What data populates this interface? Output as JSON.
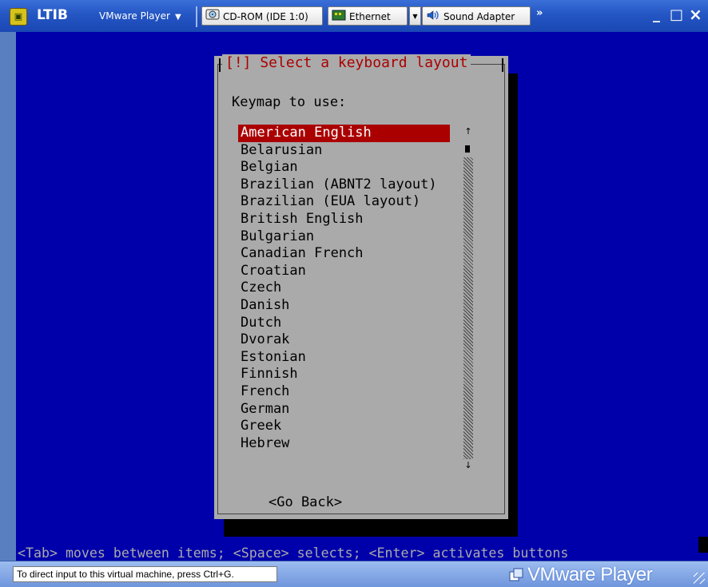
{
  "window": {
    "app_name": "LTIB",
    "menu_label": "VMware Player",
    "devices": [
      {
        "label": "CD-ROM (IDE 1:0)",
        "icon": "cdrom-icon"
      },
      {
        "label": "Ethernet",
        "icon": "network-icon"
      },
      {
        "label": "Sound Adapter",
        "icon": "speaker-icon"
      }
    ],
    "overflow_label": "»",
    "minimize_label": "_",
    "maximize_label": "□",
    "close_label": "×"
  },
  "dialog": {
    "title": "[!] Select a keyboard layout",
    "prompt": "Keymap to use:",
    "items": [
      "American English",
      "Belarusian",
      "Belgian",
      "Brazilian (ABNT2 layout)",
      "Brazilian (EUA layout)",
      "British English",
      "Bulgarian",
      "Canadian French",
      "Croatian",
      "Czech",
      "Danish",
      "Dutch",
      "Dvorak",
      "Estonian",
      "Finnish",
      "French",
      "German",
      "Greek",
      "Hebrew"
    ],
    "selected_index": 0,
    "scroll_up": "↑",
    "scroll_down": "↓",
    "back_button": "<Go Back>"
  },
  "help_line": "<Tab> moves between items; <Space> selects; <Enter> activates buttons",
  "status": {
    "message": "To direct input to this virtual machine, press Ctrl+G.",
    "brand": "VMware Player"
  },
  "colors": {
    "screen_bg": "#0000aa",
    "dialog_bg": "#aaaaaa",
    "title_fg": "#aa0000",
    "selection_bg": "#aa0000",
    "selection_fg": "#ffffff"
  }
}
